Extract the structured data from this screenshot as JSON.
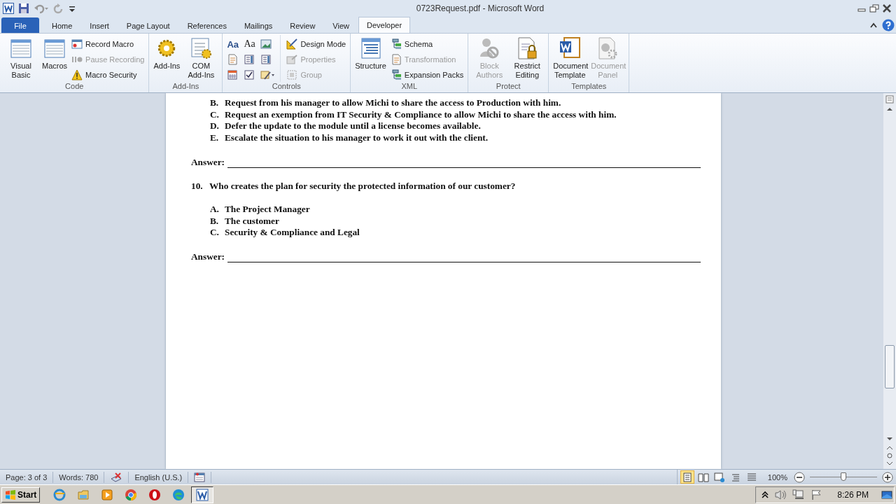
{
  "window": {
    "title": "0723Request.pdf  -  Microsoft Word"
  },
  "tabs": [
    {
      "label": "File",
      "kind": "file",
      "selected": false
    },
    {
      "label": "Home",
      "kind": "tab",
      "selected": false
    },
    {
      "label": "Insert",
      "kind": "tab",
      "selected": false
    },
    {
      "label": "Page Layout",
      "kind": "tab",
      "selected": false
    },
    {
      "label": "References",
      "kind": "tab",
      "selected": false
    },
    {
      "label": "Mailings",
      "kind": "tab",
      "selected": false
    },
    {
      "label": "Review",
      "kind": "tab",
      "selected": false
    },
    {
      "label": "View",
      "kind": "tab",
      "selected": false
    },
    {
      "label": "Developer",
      "kind": "tab",
      "selected": true
    }
  ],
  "ribbon": {
    "groups": [
      {
        "label": "Code",
        "columns": [
          [
            {
              "kind": "large",
              "label": "Visual Basic",
              "disabled": false
            }
          ],
          [
            {
              "kind": "large",
              "label": "Macros",
              "disabled": false
            }
          ],
          [
            {
              "kind": "small",
              "label": "Record Macro",
              "disabled": false
            },
            {
              "kind": "small",
              "label": "Pause Recording",
              "disabled": true
            },
            {
              "kind": "small",
              "label": "Macro Security",
              "disabled": false
            }
          ]
        ]
      },
      {
        "label": "Add-Ins",
        "columns": [
          [
            {
              "kind": "large",
              "label": "Add-Ins",
              "disabled": false
            }
          ],
          [
            {
              "kind": "large",
              "label": "COM Add-Ins",
              "disabled": false
            }
          ]
        ]
      },
      {
        "label": "Controls",
        "columns": [
          [
            {
              "kind": "tool",
              "glyph": "Aa",
              "disabled": false
            },
            {
              "kind": "tool",
              "disabled": false
            },
            {
              "kind": "tool",
              "disabled": false
            }
          ],
          [
            {
              "kind": "tool",
              "glyph": "Aa",
              "disabled": false
            },
            {
              "kind": "tool",
              "disabled": false
            },
            {
              "kind": "tool",
              "disabled": false
            }
          ],
          [
            {
              "kind": "tool",
              "disabled": false
            },
            {
              "kind": "tool",
              "disabled": false
            },
            {
              "kind": "tool",
              "disabled": false
            }
          ],
          [
            {
              "kind": "small",
              "label": "Design Mode",
              "disabled": false
            },
            {
              "kind": "small",
              "label": "Properties",
              "disabled": true
            },
            {
              "kind": "small",
              "label": "Group",
              "disabled": true
            }
          ]
        ]
      },
      {
        "label": "XML",
        "columns": [
          [
            {
              "kind": "large",
              "label": "Structure",
              "disabled": false
            }
          ],
          [
            {
              "kind": "small",
              "label": "Schema",
              "disabled": false
            },
            {
              "kind": "small",
              "label": "Transformation",
              "disabled": true
            },
            {
              "kind": "small",
              "label": "Expansion Packs",
              "disabled": false
            }
          ]
        ]
      },
      {
        "label": "Protect",
        "columns": [
          [
            {
              "kind": "large",
              "label": "Block Authors",
              "disabled": true
            }
          ],
          [
            {
              "kind": "large",
              "label": "Restrict Editing",
              "disabled": false
            }
          ]
        ]
      },
      {
        "label": "Templates",
        "columns": [
          [
            {
              "kind": "large",
              "label": "Document Template",
              "disabled": false
            }
          ],
          [
            {
              "kind": "large",
              "label": "Document Panel",
              "disabled": true
            }
          ]
        ]
      }
    ]
  },
  "document": {
    "blocks": [
      {
        "kind": "option",
        "letter": "B.",
        "text": "Request from his manager to allow Michi to share the access to Production with him."
      },
      {
        "kind": "option",
        "letter": "C.",
        "text": "Request an exemption from IT Security & Compliance to allow Michi to share the access with him."
      },
      {
        "kind": "option",
        "letter": "D.",
        "text": "Defer the update to the module until a license becomes available."
      },
      {
        "kind": "option",
        "letter": "E.",
        "text": "Escalate the situation to his manager to work it out with the client."
      },
      {
        "kind": "answer",
        "label": "Answer:"
      },
      {
        "kind": "question",
        "number": "10.",
        "text": "Who creates the plan for security the protected information of our customer?"
      },
      {
        "kind": "option",
        "letter": "A.",
        "text": "The Project Manager"
      },
      {
        "kind": "option",
        "letter": "B.",
        "text": "The customer"
      },
      {
        "kind": "option",
        "letter": "C.",
        "text": "Security & Compliance and Legal"
      },
      {
        "kind": "answer",
        "label": "Answer:"
      }
    ]
  },
  "status_bar": {
    "page": "Page: 3 of 3",
    "words": "Words: 780",
    "language": "English (U.S.)",
    "views": [
      {
        "selected": true
      },
      {
        "selected": false
      },
      {
        "selected": false
      },
      {
        "selected": false
      },
      {
        "selected": false
      }
    ],
    "zoom": {
      "reading": "100%",
      "level": 0.5
    }
  },
  "taskbar": {
    "start": "Start",
    "apps": [
      {
        "selected": false
      },
      {
        "selected": false
      },
      {
        "selected": false
      },
      {
        "selected": false
      },
      {
        "selected": false
      },
      {
        "selected": false
      },
      {
        "selected": true
      }
    ],
    "time": "8:26 PM"
  }
}
